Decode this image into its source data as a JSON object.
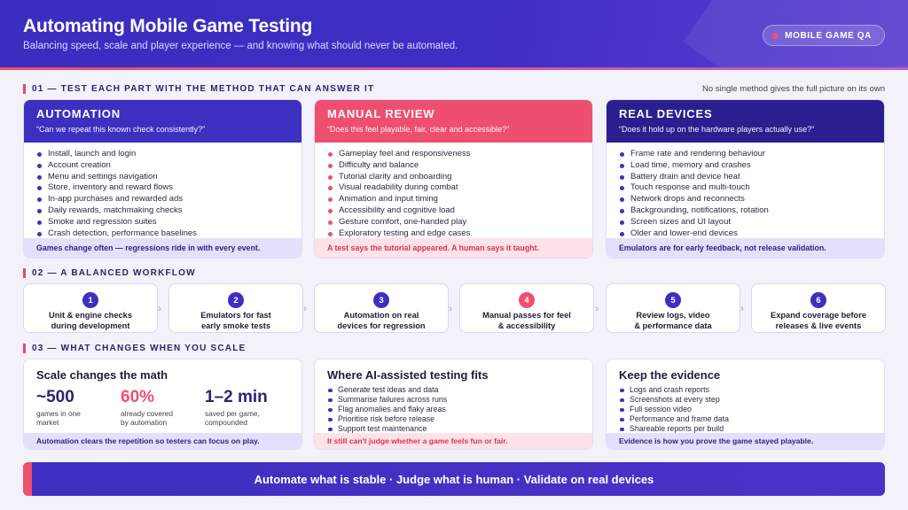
{
  "header": {
    "title": "Automating Mobile Game Testing",
    "subtitle": "Balancing speed, scale and player experience — and knowing what should never be automated.",
    "badge": "MOBILE GAME QA"
  },
  "section1": {
    "label": "01 — TEST EACH PART WITH THE METHOD THAT CAN ANSWER IT",
    "note": "No single method gives the full picture on its own",
    "columns": [
      {
        "title": "AUTOMATION",
        "question": "“Can we repeat this known check consistently?”",
        "items": [
          "Install, launch and login",
          "Account creation",
          "Menu and settings navigation",
          "Store, inventory and reward flows",
          "In-app purchases and rewarded ads",
          "Daily rewards, matchmaking checks",
          "Smoke and regression suites",
          "Crash detection, performance baselines"
        ],
        "footer": "Games change often — regressions ride in with every event."
      },
      {
        "title": "MANUAL REVIEW",
        "question": "“Does this feel playable, fair, clear and accessible?”",
        "items": [
          "Gameplay feel and responsiveness",
          "Difficulty and balance",
          "Tutorial clarity and onboarding",
          "Visual readability during combat",
          "Animation and input timing",
          "Accessibility and cognitive load",
          "Gesture comfort, one-handed play",
          "Exploratory testing and edge cases"
        ],
        "footer": "A test says the tutorial appeared. A human says it taught."
      },
      {
        "title": "REAL DEVICES",
        "question": "“Does it hold up on the hardware players actually use?”",
        "items": [
          "Frame rate and rendering behaviour",
          "Load time, memory and crashes",
          "Battery drain and device heat",
          "Touch response and multi-touch",
          "Network drops and reconnects",
          "Backgrounding, notifications, rotation",
          "Screen sizes and UI layout",
          "Older and lower-end devices"
        ],
        "footer": "Emulators are for early feedback, not release validation."
      }
    ]
  },
  "section2": {
    "label": "02 — A BALANCED WORKFLOW",
    "steps": [
      {
        "num": "1",
        "line1": "Unit & engine checks",
        "line2": "during development"
      },
      {
        "num": "2",
        "line1": "Emulators for fast",
        "line2": "early smoke tests"
      },
      {
        "num": "3",
        "line1": "Automation on real",
        "line2": "devices for regression"
      },
      {
        "num": "4",
        "line1": "Manual passes for feel",
        "line2": "& accessibility"
      },
      {
        "num": "5",
        "line1": "Review logs, video",
        "line2": "& performance data"
      },
      {
        "num": "6",
        "line1": "Expand coverage before",
        "line2": "releases & live events"
      }
    ]
  },
  "section3": {
    "label": "03 — WHAT CHANGES WHEN YOU SCALE",
    "scale": {
      "title": "Scale changes the math",
      "stats": [
        {
          "value": "~500",
          "label1": "games in one",
          "label2": "market"
        },
        {
          "value": "60%",
          "label1": "already covered",
          "label2": "by automation"
        },
        {
          "value": "1–2 min",
          "label1": "saved per game,",
          "label2": "compounded"
        }
      ],
      "footer": "Automation clears the repetition so testers can focus on play."
    },
    "ai": {
      "title": "Where AI-assisted testing fits",
      "items": [
        "Generate test ideas and data",
        "Summarise failures across runs",
        "Flag anomalies and flaky areas",
        "Prioritise risk before release",
        "Support test maintenance"
      ],
      "footer": "It still can't judge whether a game feels fun or fair."
    },
    "evidence": {
      "title": "Keep the evidence",
      "items": [
        "Logs and crash reports",
        "Screenshots at every step",
        "Full session video",
        "Performance and frame data",
        "Shareable reports per build"
      ],
      "footer": "Evidence is how you prove the game stayed playable."
    }
  },
  "banner": "Automate what is stable · Judge what is human · Validate on real devices",
  "colors": {
    "indigo": "#3d2fc0",
    "pink": "#ef4f6f",
    "dark_indigo": "#2b1f8f"
  }
}
